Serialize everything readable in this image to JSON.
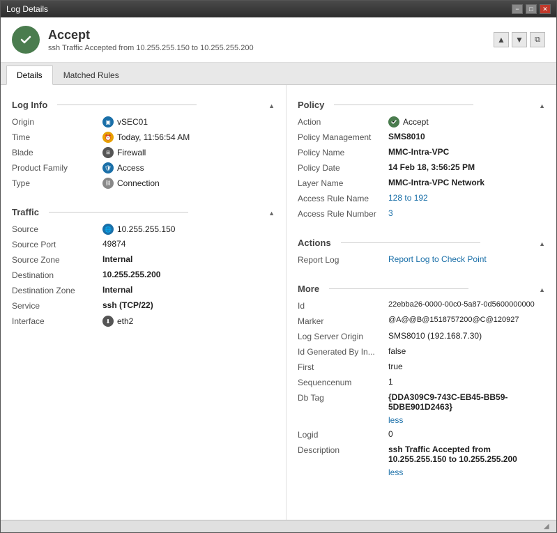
{
  "window": {
    "title": "Log Details",
    "minimize_label": "−",
    "maximize_label": "□",
    "close_label": "✕"
  },
  "header": {
    "icon_letter": "✓",
    "title": "Accept",
    "subtitle": "ssh Traffic Accepted from 10.255.255.150 to 10.255.255.200",
    "nav_up": "▲",
    "nav_down": "▼",
    "nav_copy": "⧉"
  },
  "tabs": [
    {
      "label": "Details",
      "active": true
    },
    {
      "label": "Matched Rules",
      "active": false
    }
  ],
  "log_info": {
    "section_title": "Log Info",
    "fields": [
      {
        "label": "Origin",
        "value": "vSEC01",
        "icon": "server"
      },
      {
        "label": "Time",
        "value": "Today, 11:56:54 AM",
        "icon": "clock"
      },
      {
        "label": "Blade",
        "value": "Firewall",
        "icon": "grid"
      },
      {
        "label": "Product Family",
        "value": "Access",
        "icon": "shield"
      },
      {
        "label": "Type",
        "value": "Connection",
        "icon": "chain"
      }
    ]
  },
  "traffic": {
    "section_title": "Traffic",
    "fields": [
      {
        "label": "Source",
        "value": "10.255.255.150",
        "icon": "globe"
      },
      {
        "label": "Source Port",
        "value": "49874"
      },
      {
        "label": "Source Zone",
        "value": "Internal",
        "bold": true
      },
      {
        "label": "Destination",
        "value": "10.255.255.200",
        "bold": true
      },
      {
        "label": "Destination Zone",
        "value": "Internal",
        "bold": true
      },
      {
        "label": "Service",
        "value": "ssh (TCP/22)",
        "bold": true
      },
      {
        "label": "Interface",
        "value": "eth2",
        "icon": "down"
      }
    ]
  },
  "policy": {
    "section_title": "Policy",
    "fields": [
      {
        "label": "Action",
        "value": "Accept",
        "icon": "accept"
      },
      {
        "label": "Policy Management",
        "value": "SMS8010",
        "bold": true
      },
      {
        "label": "Policy Name",
        "value": "MMC-Intra-VPC",
        "bold": true
      },
      {
        "label": "Policy Date",
        "value": "14 Feb 18, 3:56:25 PM",
        "bold": true
      },
      {
        "label": "Layer Name",
        "value": "MMC-Intra-VPC Network",
        "bold": true
      },
      {
        "label": "Access Rule Name",
        "value": "128 to 192",
        "link": true
      },
      {
        "label": "Access Rule Number",
        "value": "3",
        "link": true
      }
    ]
  },
  "actions": {
    "section_title": "Actions",
    "fields": [
      {
        "label": "Report Log",
        "value": "Report Log to Check Point",
        "link": true
      }
    ]
  },
  "more": {
    "section_title": "More",
    "fields": [
      {
        "label": "Id",
        "value": "22ebba26-0000-00c0-5a87-0d5600000000"
      },
      {
        "label": "Marker",
        "value": "@A@@B@1518757200@C@120927"
      },
      {
        "label": "Log Server Origin",
        "value": "SMS8010 (192.168.7.30)"
      },
      {
        "label": "Id Generated By In...",
        "value": "false"
      },
      {
        "label": "First",
        "value": "true"
      },
      {
        "label": "Sequencenum",
        "value": "1"
      },
      {
        "label": "Db Tag",
        "value": "{DDA309C9-743C-EB45-BB59-5DBE901D2463}",
        "has_less": true
      },
      {
        "label": "Logid",
        "value": "0"
      },
      {
        "label": "Description",
        "value": "ssh Traffic Accepted from 10.255.255.150 to 10.255.255.200",
        "has_less": true
      }
    ]
  }
}
